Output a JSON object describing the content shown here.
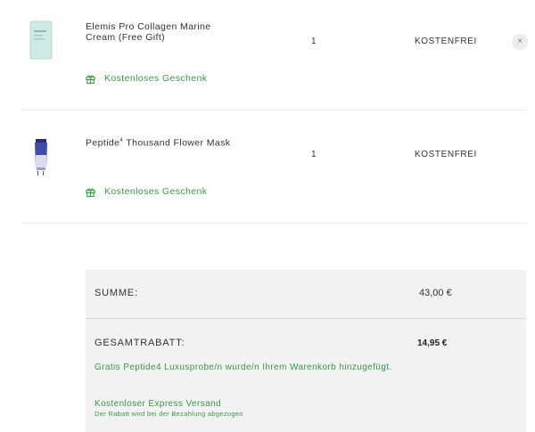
{
  "cart": {
    "items": [
      {
        "name": "Elemis Pro Collagen Marine Cream (Free Gift)",
        "quantity": "1",
        "price": "KOSTENFREI",
        "gift_label": "Kostenloses Geschenk",
        "thumbnail_color": "#cfe9e6",
        "remove_symbol": "×"
      },
      {
        "name": "Peptide",
        "name_superscript": "4",
        "name_rest": " Thousand Flower Mask",
        "quantity": "1",
        "price": "KOSTENFREI",
        "gift_label": "Kostenloses Geschenk",
        "thumbnail_color": "#3f4da8"
      }
    ]
  },
  "summary": {
    "total_label": "SUMME:",
    "total_value": "43,00 €",
    "discount_label": "GESAMTRABATT:",
    "discount_value": "14,95 €",
    "discount_message": "Gratis Peptide4 Luxusprobe/n wurde/n Ihrem Warenkorb hinzugefügt.",
    "shipping_title": "Kostenloser Express Versand",
    "shipping_note": "Der Rabatt wird bei der Bezahlung abgezogen"
  },
  "colors": {
    "accent_green": "#3a9a47",
    "summary_bg": "#f2f2f2"
  },
  "icons": {
    "gift": "gift-icon",
    "remove": "close-icon"
  }
}
